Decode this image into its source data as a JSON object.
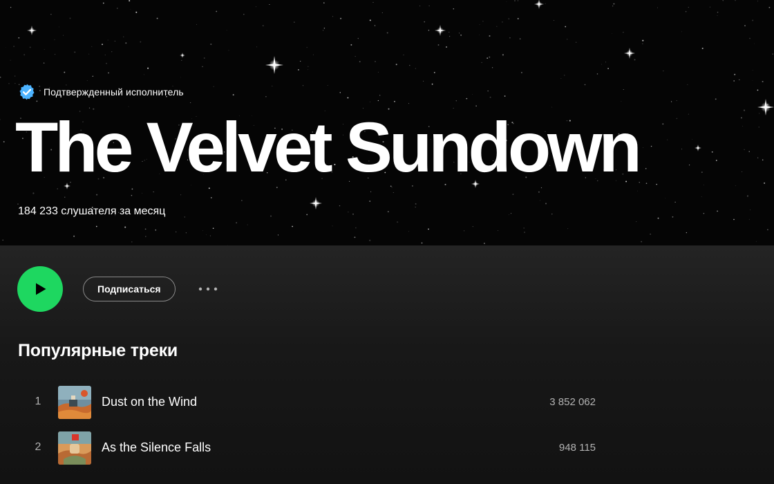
{
  "hero": {
    "verified_label": "Подтвержденный исполнитель",
    "artist_name": "The Velvet Sundown",
    "monthly_listeners": "184 233 слушателя за месяц"
  },
  "actions": {
    "play_icon": "play-icon",
    "follow_label": "Подписаться",
    "more_icon": "more-options-icon"
  },
  "popular": {
    "section_title": "Популярные треки",
    "tracks": [
      {
        "number": "1",
        "title": "Dust on the Wind",
        "plays": "3 852 062"
      },
      {
        "number": "2",
        "title": "As the Silence Falls",
        "plays": "948 115"
      }
    ]
  },
  "colors": {
    "accent_green": "#1ed760",
    "verified_blue": "#4cb3ff",
    "background": "#121212",
    "secondary_text": "#b3b3b3"
  }
}
